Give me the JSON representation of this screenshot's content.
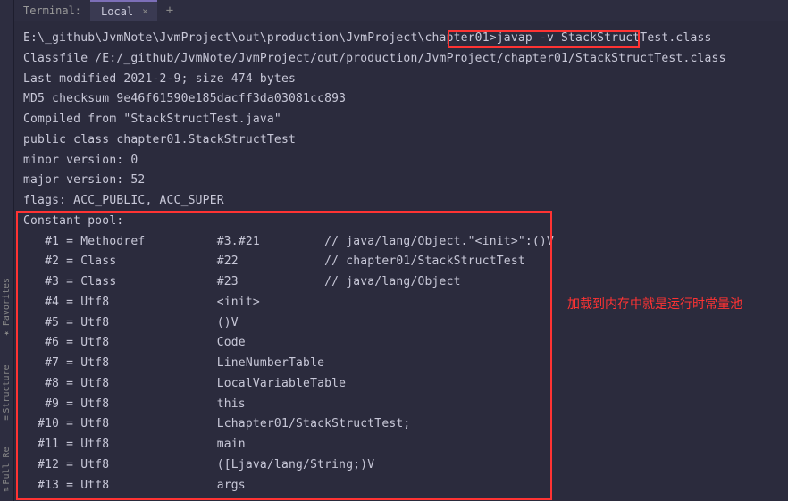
{
  "sidebar": {
    "items": [
      {
        "label": "Favorites"
      },
      {
        "label": "Structure"
      },
      {
        "label": "Pull Re"
      }
    ]
  },
  "tabbar": {
    "terminal_label": "Terminal:",
    "tab_label": "Local",
    "close_glyph": "×",
    "add_glyph": "+"
  },
  "prompt": {
    "path": "E:\\_github\\JvmNote\\JvmProject\\out\\production\\JvmProject\\chapter01>",
    "command": "javap -v StackStructTest.class"
  },
  "output": {
    "classfile": "Classfile /E:/_github/JvmNote/JvmProject/out/production/JvmProject/chapter01/StackStructTest.class",
    "last_modified": "  Last modified 2021-2-9; size 474 bytes",
    "md5": "  MD5 checksum 9e46f61590e185dacff3da03081cc893",
    "compiled_from": "  Compiled from \"StackStructTest.java\"",
    "public_class": "public class chapter01.StackStructTest",
    "minor_version": "  minor version: 0",
    "major_version": "  major version: 52",
    "flags": "  flags: ACC_PUBLIC, ACC_SUPER",
    "constant_pool_header": "Constant pool:"
  },
  "constant_pool": [
    "   #1 = Methodref          #3.#21         // java/lang/Object.\"<init>\":()V",
    "   #2 = Class              #22            // chapter01/StackStructTest",
    "   #3 = Class              #23            // java/lang/Object",
    "   #4 = Utf8               <init>",
    "   #5 = Utf8               ()V",
    "   #6 = Utf8               Code",
    "   #7 = Utf8               LineNumberTable",
    "   #8 = Utf8               LocalVariableTable",
    "   #9 = Utf8               this",
    "  #10 = Utf8               Lchapter01/StackStructTest;",
    "  #11 = Utf8               main",
    "  #12 = Utf8               ([Ljava/lang/String;)V",
    "  #13 = Utf8               args"
  ],
  "annotation": "加载到内存中就是运行时常量池"
}
